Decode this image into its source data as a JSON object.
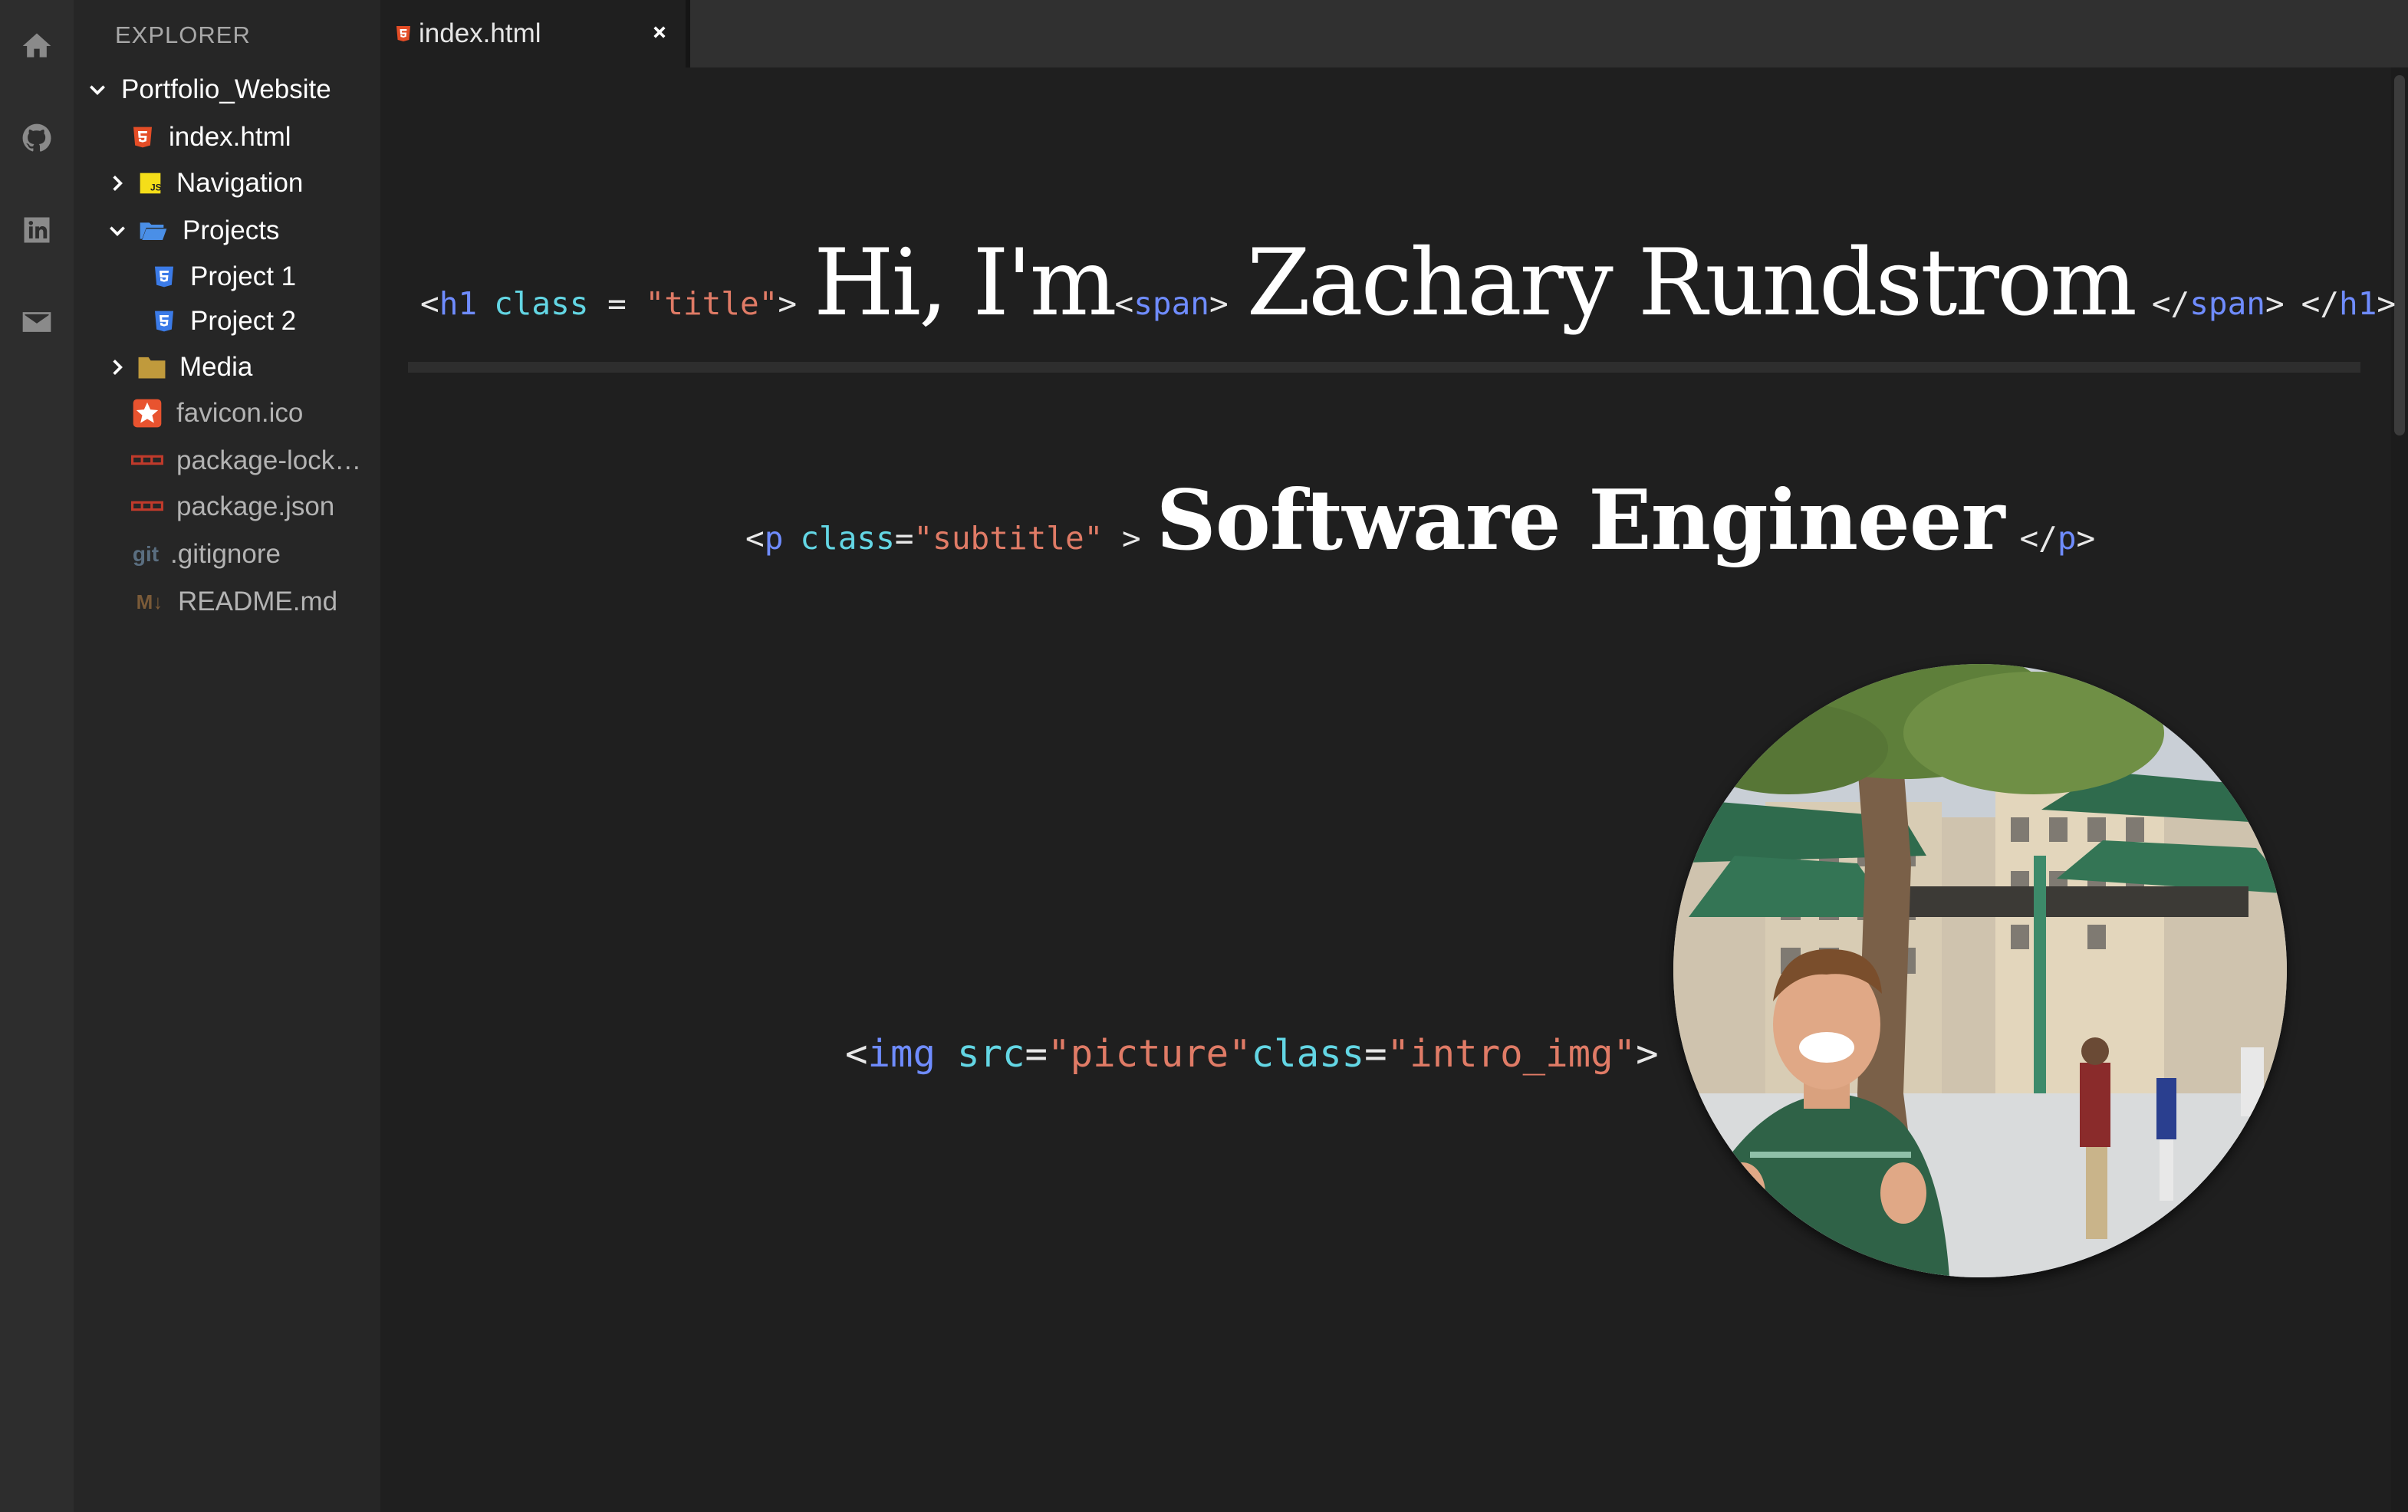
{
  "activity_bar": {
    "icons": [
      "home-icon",
      "github-icon",
      "linkedin-icon",
      "mail-icon"
    ]
  },
  "sidebar": {
    "title": "EXPLORER",
    "root": "Portfolio_Website",
    "items": [
      {
        "label": "index.html",
        "icon": "html5-icon"
      },
      {
        "label": "Navigation",
        "icon": "javascript-icon"
      },
      {
        "label": "Projects",
        "icon": "open-folder-icon"
      },
      {
        "label": "Project 1",
        "icon": "css3-icon"
      },
      {
        "label": "Project 2",
        "icon": "css3-icon"
      },
      {
        "label": "Media",
        "icon": "folder-icon"
      },
      {
        "label": "favicon.ico",
        "icon": "star-icon"
      },
      {
        "label": "package-lock…",
        "icon": "npm-icon"
      },
      {
        "label": "package.json",
        "icon": "npm-icon"
      },
      {
        "label": ".gitignore",
        "icon": "git-icon",
        "icon_text": "git"
      },
      {
        "label": "README.md",
        "icon": "markdown-icon",
        "icon_text": "M↓"
      }
    ]
  },
  "tab": {
    "label": "index.html",
    "close": "×"
  },
  "editor": {
    "h1": {
      "open": "<",
      "tag": "h1",
      "attr": "class",
      "eq": " = ",
      "value": "\"title\"",
      "close": ">",
      "text": "Hi, I'm",
      "span_open_lt": "<",
      "span_tag": "span",
      "span_open_gt": ">",
      "name": "Zachary Rundstrom",
      "span_close_lt": "</",
      "span_close_gt": ">",
      "h1_close_lt": "</",
      "h1_close_gt": ">"
    },
    "p": {
      "open": "<",
      "tag": "p",
      "attr": "class",
      "eq": "=",
      "value": "\"subtitle\"",
      "close": " >",
      "text": "Software Engineer",
      "close_lt": "</",
      "close_gt": ">"
    },
    "img": {
      "open": "<",
      "tag": "img",
      "attr_src": "src",
      "eq": "=",
      "src_value": "\"picture\"",
      "attr_class": "class",
      "class_value": "\"intro_img\"",
      "close": ">"
    }
  },
  "colors": {
    "tag": "#6f8cff",
    "attr": "#63d6e4",
    "string": "#e07b66",
    "html_icon": "#e44d26",
    "css_icon": "#3b7be8",
    "js_icon": "#f5de19",
    "folder": "#c09a3c",
    "open_folder": "#4a8fe7"
  }
}
